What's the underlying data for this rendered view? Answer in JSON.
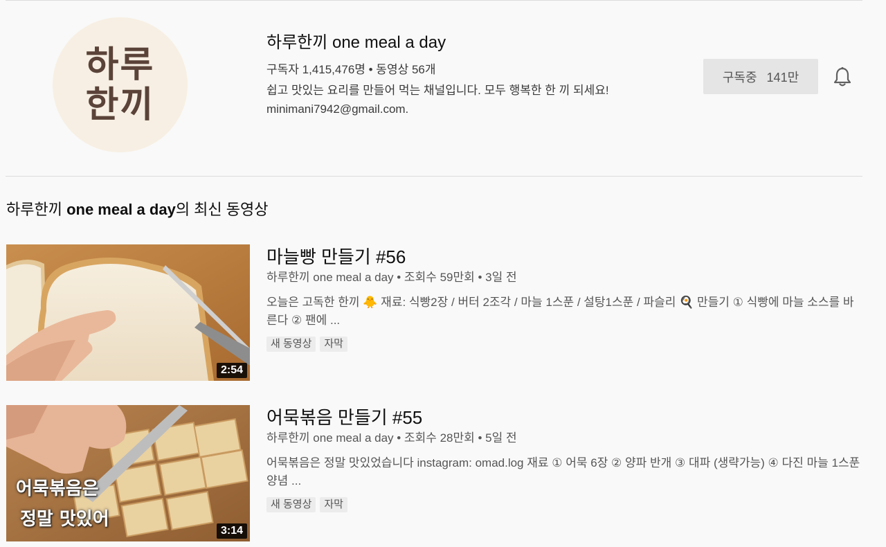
{
  "channel": {
    "logo_line1": "하루",
    "logo_line2": "한끼",
    "title": "하루한끼 one meal a day",
    "meta": "구독자 1,415,476명 • 동영상 56개",
    "description": "쉽고 맛있는 요리를 만들어 먹는 채널입니다. 모두 행복한 한 끼 되세요!",
    "email": "minimani7942@gmail.com.",
    "subscribe_label": "구독중",
    "subscribe_count": "141만"
  },
  "section": {
    "title_prefix": "하루한끼 ",
    "title_bold": "one meal a day",
    "title_suffix": "의 최신 동영상"
  },
  "videos": [
    {
      "title": "마늘빵 만들기 #56",
      "meta": "하루한끼 one meal a day • 조회수 59만회 • 3일 전",
      "description": "오늘은 고독한 한끼 🐥 재료: 식빵2장 / 버터 2조각 / 마늘 1스푼 / 설탕1스푼 / 파슬리 🍳 만들기 ① 식빵에 마늘 소스를 바른다 ② 팬에 ...",
      "badges": [
        "새 동영상",
        "자막"
      ],
      "duration": "2:54",
      "thumb_text": [
        "",
        ""
      ]
    },
    {
      "title": "어묵볶음 만들기 #55",
      "meta": "하루한끼 one meal a day • 조회수 28만회 • 5일 전",
      "description": "어묵볶음은 정말 맛있었습니다 instagram: omad.log 재료 ① 어묵 6장 ② 양파 반개 ③ 대파 (생략가능) ④ 다진 마늘 1스푼 양념 ...",
      "badges": [
        "새 동영상",
        "자막"
      ],
      "duration": "3:14",
      "thumb_text": [
        "어묵볶음은",
        "정말 맛있어"
      ]
    }
  ],
  "colors": {
    "background": "#f9f9f9",
    "subscribe_bg": "#e5e5e5",
    "logo_brown": "#5b4339",
    "logo_bg": "#f7efe3"
  },
  "icons": {
    "bell": "bell-icon"
  }
}
